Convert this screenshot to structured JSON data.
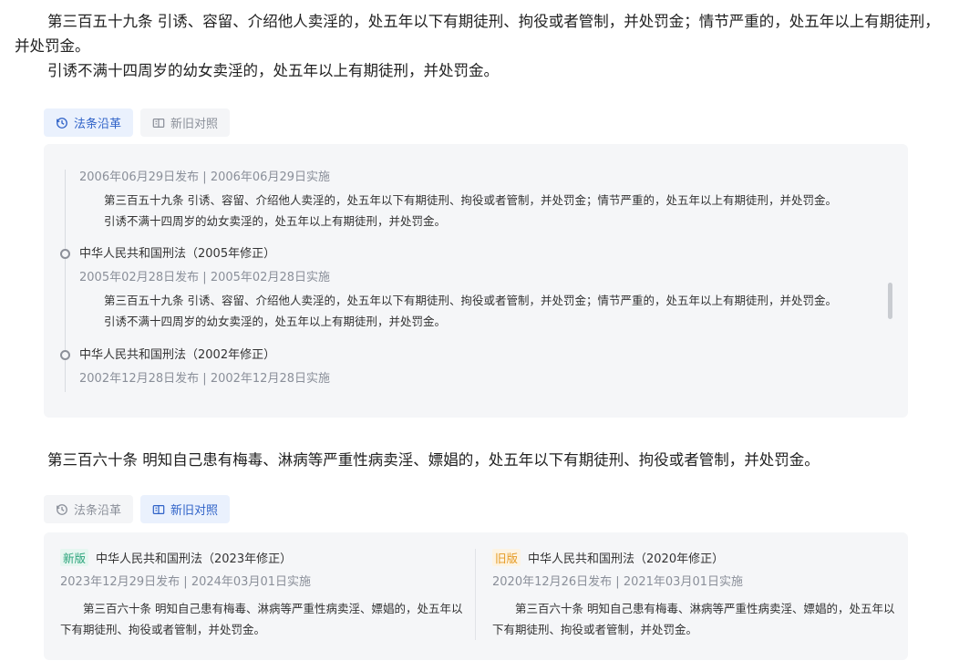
{
  "article359": {
    "para1": "第三百五十九条 引诱、容留、介绍他人卖淫的，处五年以下有期徒刑、拘役或者管制，并处罚金；情节严重的，处五年以上有期徒刑，并处罚金。",
    "para2": "引诱不满十四周岁的幼女卖淫的，处五年以上有期徒刑，并处罚金。"
  },
  "tabs1": {
    "history_label": "法条沿革",
    "compare_label": "新旧对照",
    "active": "history"
  },
  "history": {
    "entries": [
      {
        "title": "",
        "date": "2006年06月29日发布 | 2006年06月29日实施",
        "text1": "第三百五十九条 引诱、容留、介绍他人卖淫的，处五年以下有期徒刑、拘役或者管制，并处罚金；情节严重的，处五年以上有期徒刑，并处罚金。",
        "text2": "引诱不满十四周岁的幼女卖淫的，处五年以上有期徒刑，并处罚金。"
      },
      {
        "title": "中华人民共和国刑法（2005年修正）",
        "date": "2005年02月28日发布 | 2005年02月28日实施",
        "text1": "第三百五十九条 引诱、容留、介绍他人卖淫的，处五年以下有期徒刑、拘役或者管制，并处罚金；情节严重的，处五年以上有期徒刑，并处罚金。",
        "text2": "引诱不满十四周岁的幼女卖淫的，处五年以上有期徒刑，并处罚金。"
      },
      {
        "title": "中华人民共和国刑法（2002年修正）",
        "date": "2002年12月28日发布 | 2002年12月28日实施"
      }
    ]
  },
  "article360": {
    "para1": "第三百六十条 明知自己患有梅毒、淋病等严重性病卖淫、嫖娼的，处五年以下有期徒刑、拘役或者管制，并处罚金。"
  },
  "tabs2": {
    "history_label": "法条沿革",
    "compare_label": "新旧对照",
    "active": "compare"
  },
  "compare": {
    "new": {
      "badge": "新版",
      "title": "中华人民共和国刑法（2023年修正）",
      "date": "2023年12月29日发布 | 2024年03月01日实施",
      "text": "第三百六十条 明知自己患有梅毒、淋病等严重性病卖淫、嫖娼的，处五年以下有期徒刑、拘役或者管制，并处罚金。"
    },
    "old": {
      "badge": "旧版",
      "title": "中华人民共和国刑法（2020年修正）",
      "date": "2020年12月26日发布 | 2021年03月01日实施",
      "text": "第三百六十条 明知自己患有梅毒、淋病等严重性病卖淫、嫖娼的，处五年以下有期徒刑、拘役或者管制，并处罚金。"
    }
  },
  "colors": {
    "accent": "#2f62c8",
    "new_badge": "#2aa37a",
    "old_badge": "#e59a22"
  }
}
